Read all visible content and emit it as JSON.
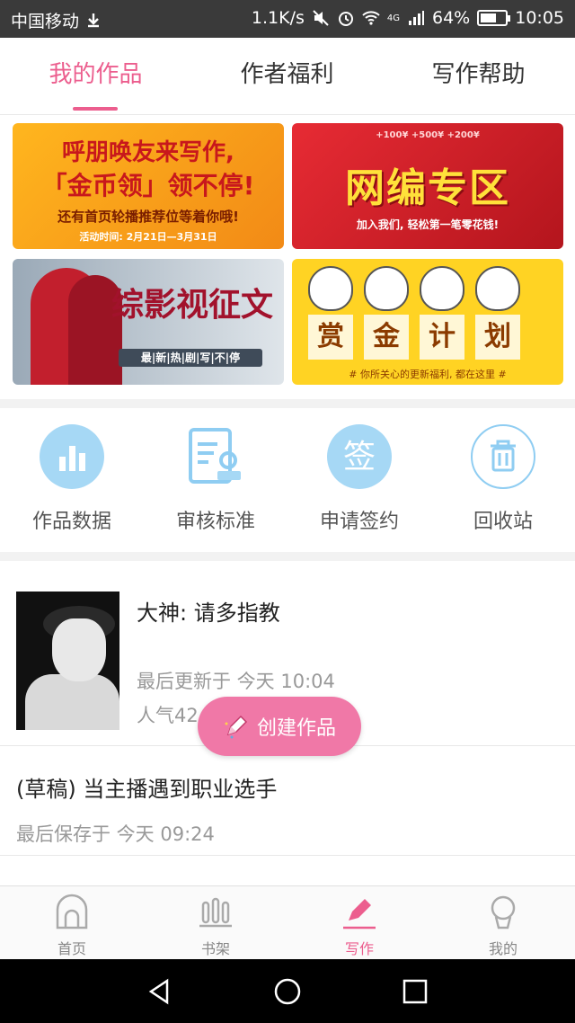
{
  "status_bar": {
    "carrier": "中国移动",
    "speed": "1.1K/s",
    "network": "4G",
    "battery": "64%",
    "battery_level": 0.64,
    "time": "10:05"
  },
  "tabs": [
    {
      "label": "我的作品",
      "active": true
    },
    {
      "label": "作者福利",
      "active": false
    },
    {
      "label": "写作帮助",
      "active": false
    }
  ],
  "banners": {
    "banner1": {
      "line1": "呼朋唤友来写作,",
      "line2": "「金币领」领不停!",
      "line3": "还有首页轮播推荐位等着你哦!",
      "line4": "活动时间: 2月21日—3月31日"
    },
    "banner2": {
      "small": "+100¥ +500¥ +200¥",
      "title": "网编专区",
      "sub": "加入我们, 轻松第一笔零花钱!"
    },
    "banner3": {
      "title": "综影视征文",
      "sub": "最|新|热|剧|写|不|停"
    },
    "banner4": {
      "chars": [
        "赏",
        "金",
        "计",
        "划"
      ],
      "sub": "# 你所关心的更新福利, 都在这里 #"
    }
  },
  "quick_actions": [
    {
      "label": "作品数据",
      "icon": "bar-chart-icon"
    },
    {
      "label": "审核标准",
      "icon": "review-document-icon"
    },
    {
      "label": "申请签约",
      "icon": "sign-contract-icon"
    },
    {
      "label": "回收站",
      "icon": "trash-icon"
    }
  ],
  "works": [
    {
      "title": "大神: 请多指教",
      "updated": "最后更新于 今天 10:04",
      "popularity": "人气42"
    }
  ],
  "drafts": [
    {
      "title": "(草稿) 当主播遇到职业选手",
      "saved": "最后保存于 今天 09:24"
    }
  ],
  "fab": {
    "label": "创建作品"
  },
  "bottom_nav": [
    {
      "label": "首页",
      "icon": "home-icon",
      "active": false
    },
    {
      "label": "书架",
      "icon": "bookshelf-icon",
      "active": false
    },
    {
      "label": "写作",
      "icon": "pen-icon",
      "active": true
    },
    {
      "label": "我的",
      "icon": "profile-icon",
      "active": false
    }
  ],
  "colors": {
    "accent": "#ec5e8e",
    "fab": "#f078a7",
    "icon_blue": "#a6d8f5"
  }
}
